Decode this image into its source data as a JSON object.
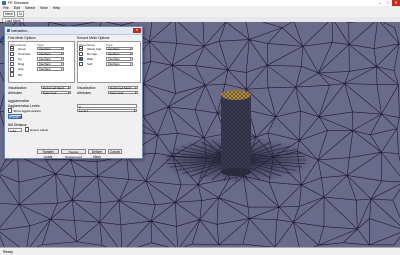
{
  "window": {
    "title": "FE Simulator",
    "min": "–",
    "max": "□",
    "close": "✕"
  },
  "menu": [
    "File",
    "Edit",
    "Select",
    "View",
    "Help"
  ],
  "toolbar": {
    "combo1": "Mesh",
    "combo2": "Jo"
  },
  "tabs": [
    {
      "label": "Load Mesh"
    }
  ],
  "viewport": {
    "bg_color": "#6a6a8a",
    "mesh_color": "#1c1c34",
    "cylinder_top_color": "#b08a3a"
  },
  "dialog": {
    "title": "Interaction...",
    "first_mesh": {
      "heading": "First Mesh Options",
      "columns": [
        "Show",
        "Name",
        "Type"
      ],
      "rows": [
        {
          "checked": true,
          "name": "Grout",
          "type": "Interface"
        },
        {
          "checked": false,
          "name": "Concrete",
          "type": "Interface"
        },
        {
          "checked": false,
          "name": "Cy",
          "type": "Interface"
        },
        {
          "checked": false,
          "name": "Ring",
          "type": "Interface"
        },
        {
          "checked": false,
          "name": "Cap",
          "type": "Interface"
        },
        {
          "checked": false,
          "name": "RG",
          "type": ""
        }
      ],
      "visualization_label": "Visualization",
      "visualization_value": "Deformed Mesh",
      "attributes_label": "Attributes",
      "attributes_value": "Sans.Isotr..."
    },
    "second_mesh": {
      "heading": "Second Mesh Options",
      "columns": [
        "Show",
        "Name",
        "Type"
      ],
      "rows": [
        {
          "checked": true,
          "name": "Ghost Cap",
          "type": "Interface"
        },
        {
          "checked": false,
          "name": "Bn Cap",
          "type": "Interface"
        },
        {
          "checked": true,
          "name": "Wall",
          "type": "Interface"
        },
        {
          "checked": false,
          "name": "Soil",
          "type": "Interface"
        }
      ],
      "visualization_label": "Visualization",
      "visualization_value": "Deformed Mesh",
      "attributes_label": "Attributes",
      "attributes_value": "Sans.Isotr..."
    },
    "agglomeration": {
      "heading": "Agglomeration",
      "levels_label": "Agglomeration Levels",
      "levels_value": "0",
      "level_select": "Level 1",
      "show_label": "Show Agglomeration",
      "update_button": "Generate"
    },
    "ip_distance": {
      "heading": "NM Distance",
      "value": "1.00",
      "export_label": "Export Latest"
    },
    "buttons": {
      "transfer_loads": "Transfer Loads",
      "transfer_disp": "Transfer Displacement",
      "deform_mesh": "Deform Mesh",
      "cancel": "Cancel"
    }
  },
  "status": {
    "text": "Ready"
  }
}
